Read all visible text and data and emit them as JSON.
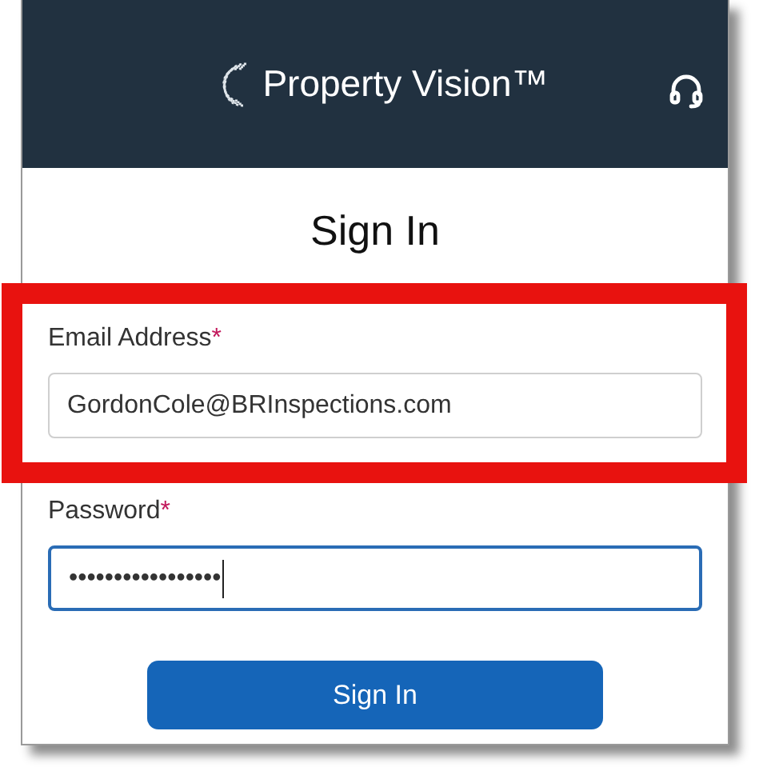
{
  "header": {
    "brand": "Property Vision™"
  },
  "title": "Sign In",
  "fields": [
    {
      "label": "Email Address",
      "required_mark": "*",
      "value": "GordonCole@BRInspections.com",
      "focused": false,
      "highlighted": true,
      "caret": false
    },
    {
      "label": "Password",
      "required_mark": "*",
      "value": "•••••••••••••••••",
      "focused": true,
      "highlighted": false,
      "caret": true
    }
  ],
  "submit": "Sign In"
}
